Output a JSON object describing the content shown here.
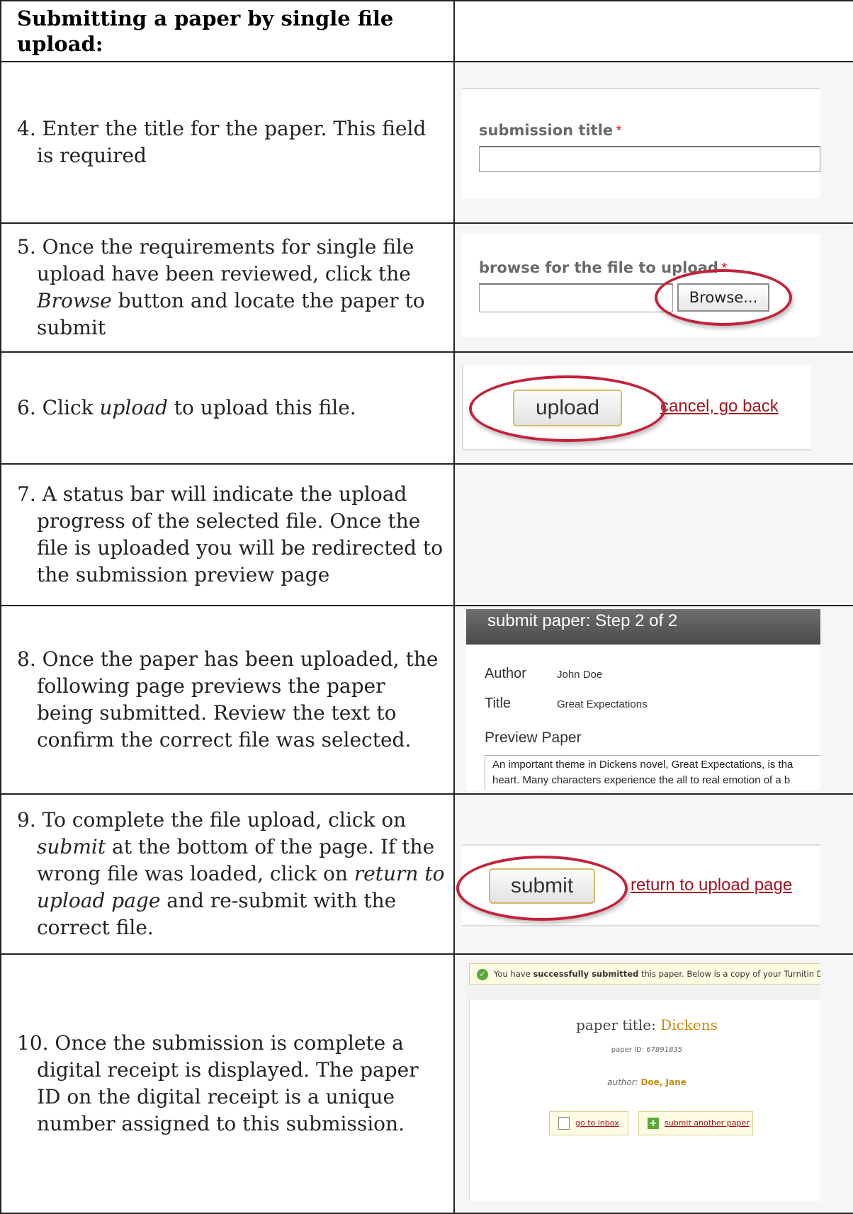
{
  "header": {
    "title": "Submitting a paper by single file upload:"
  },
  "steps": {
    "s4": {
      "text": "4. Enter the title for the paper. This field is required"
    },
    "s5": {
      "pre": "5. Once the requirements for single file upload have been reviewed, click the ",
      "em": "Browse",
      "post": " button and locate the paper to submit"
    },
    "s6": {
      "pre": "6. Click ",
      "em": "upload",
      "post": " to upload this file."
    },
    "s7": {
      "text": "7. A status bar will indicate the upload progress of the selected file. Once the file is uploaded you will be redirected to the submission preview page"
    },
    "s8": {
      "text": "8. Once the paper has been uploaded, the following page previews the paper being submitted. Review the text to confirm the correct file was selected."
    },
    "s9": {
      "pre": "9. To complete the file upload, click on ",
      "em1": "submit",
      "mid": " at the bottom of the page. If the wrong file was loaded, click on ",
      "em2": "return to upload page",
      "post": " and re-submit with the correct file."
    },
    "s10": {
      "text": "10. Once the submission is complete a digital receipt is displayed. The paper ID on the digital receipt is a unique number assigned to this submission."
    }
  },
  "shots": {
    "title_field": {
      "label": "submission title",
      "required_mark": "*"
    },
    "browse": {
      "label": "browse for the file to upload",
      "required_mark": "*",
      "button": "Browse..."
    },
    "upload": {
      "button": "upload",
      "cancel_link": "cancel, go back"
    },
    "preview": {
      "header": "submit paper: Step 2 of 2",
      "author_label": "Author",
      "author_value": "John Doe",
      "title_label": "Title",
      "title_value": "Great Expectations",
      "preview_label": "Preview Paper",
      "line1": "An important theme in Dickens novel, Great Expectations, is tha",
      "line2": "heart. Many characters experience the all to real emotion of a b"
    },
    "submit": {
      "button": "submit",
      "return_link": "return to upload page"
    },
    "receipt": {
      "banner_pre": "You have ",
      "banner_bold": "successfully submitted",
      "banner_post": " this paper. Below is a copy of your Turnitin Digital Recei",
      "paper_title_label": "paper title:",
      "paper_title_value": "Dickens",
      "paper_id_label": "paper ID:",
      "paper_id_value": "67891835",
      "author_label": "author:",
      "author_value": "Doe, Jane",
      "inbox_link": "go to inbox",
      "another_link": "submit another paper"
    }
  },
  "colors": {
    "circle": "#c4223a",
    "link_red": "#a5111c",
    "title_gold": "#c98a10"
  }
}
